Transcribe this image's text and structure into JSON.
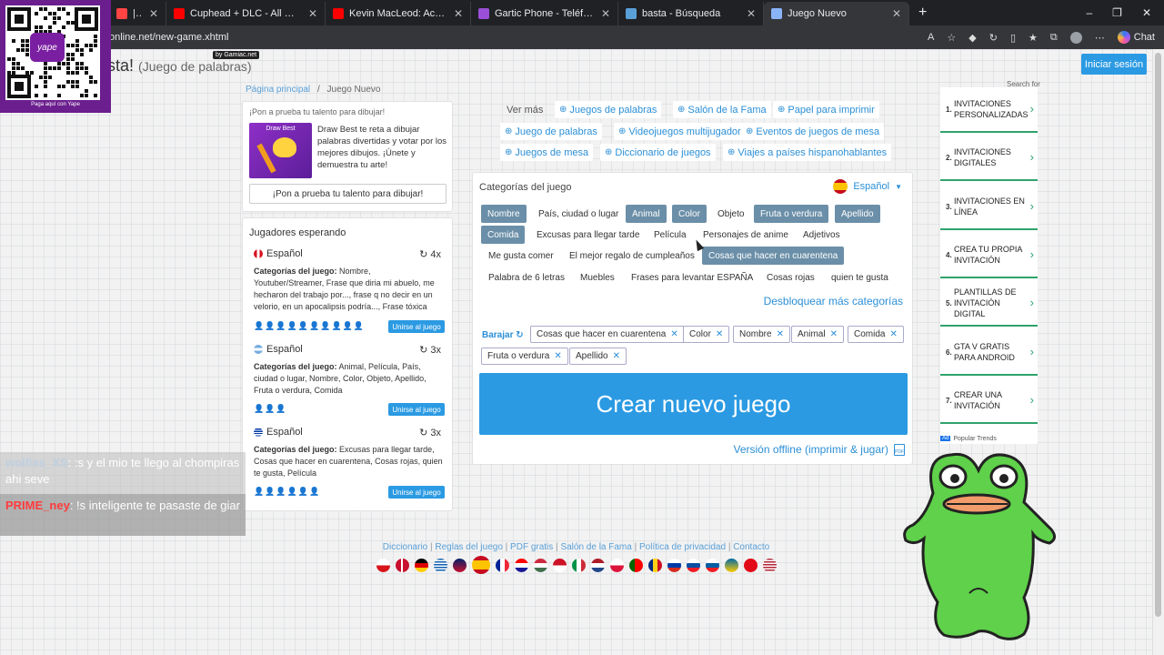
{
  "browser": {
    "tabs": [
      {
        "title": "|nl - Studiopo",
        "color": "#ff4444"
      },
      {
        "title": "Cuphead + DLC - All Bosses Sounc",
        "color": "#ff0000"
      },
      {
        "title": "Kevin MacLeod: Aces High bu",
        "color": "#ff0000"
      },
      {
        "title": "Gartic Phone - Teléfono Descomp",
        "color": "#9b4fd6"
      },
      {
        "title": "basta - Búsqueda",
        "color": "#5aa0d8"
      },
      {
        "title": "Juego Nuevo",
        "color": "#8ab4f8"
      }
    ],
    "url": "online.net/new-game.xhtml",
    "chat_label": "Chat"
  },
  "header": {
    "title": "sta!",
    "subtitle": "(Juego de palabras)",
    "badge": "by Gamiac.net",
    "login": "Iniciar sesión"
  },
  "breadcrumb": {
    "home": "Página principal",
    "sep": "/",
    "current": "Juego Nuevo"
  },
  "promo": {
    "title": "¡Pon a prueba tu talento para dibujar!",
    "image_caption": "Draw Best",
    "text": "Draw Best te reta a dibujar palabras divertidas y votar por los mejores dibujos. ¡Únete y demuestra tu arte!",
    "button": "¡Pon a prueba tu talento para dibujar!"
  },
  "players": {
    "title": "Jugadores esperando",
    "cats_label": "Categorías del juego:",
    "join_label": "Unirse al juego",
    "games": [
      {
        "lang": "Español",
        "flag": "peru",
        "count": "4x",
        "cats": "Nombre, Youtuber/Streamer, Frase que diria mi abuelo, me hecharon del trabajo por..., frase q no decir en un velorio, en un apocalipsis podría..., Frase tóxica",
        "people": "👤👤👤👤👤👤👤👤👤👤"
      },
      {
        "lang": "Español",
        "flag": "argentina",
        "count": "3x",
        "cats": "Animal, Película, País, ciudad o lugar, Nombre, Color, Objeto, Apellido, Fruta o verdura, Comida",
        "people": "👤👤👤"
      },
      {
        "lang": "Español",
        "flag": "uruguay",
        "count": "3x",
        "cats": "Excusas para llegar tarde, Cosas que hacer en cuarentena, Cosas rojas, quien te gusta, Película",
        "people": "👤👤👤👤👤👤"
      }
    ]
  },
  "toplinks": {
    "ver_mas": "Ver más",
    "links": [
      "Juegos de palabras",
      "Salón de la Fama",
      "Papel para imprimir",
      "Juego de palabras",
      "Videojuegos multijugador",
      "Eventos de juegos de mesa",
      "Juegos de mesa",
      "Diccionario de juegos",
      "Viajes a países hispanohablantes"
    ]
  },
  "game": {
    "title": "Categorías del juego",
    "language": "Español",
    "categories": [
      {
        "label": "Nombre",
        "selected": true
      },
      {
        "label": "País, ciudad o lugar",
        "selected": false
      },
      {
        "label": "Animal",
        "selected": true
      },
      {
        "label": "Color",
        "selected": true
      },
      {
        "label": "Objeto",
        "selected": false
      },
      {
        "label": "Fruta o verdura",
        "selected": true
      },
      {
        "label": "Apellido",
        "selected": true
      },
      {
        "label": "Comida",
        "selected": true
      },
      {
        "label": "Excusas para llegar tarde",
        "selected": false
      },
      {
        "label": "Película",
        "selected": false
      },
      {
        "label": "Personajes de anime",
        "selected": false
      },
      {
        "label": "Adjetivos",
        "selected": false
      },
      {
        "label": "Me gusta comer",
        "selected": false
      },
      {
        "label": "El mejor regalo de cumpleaños",
        "selected": false
      },
      {
        "label": "Cosas que hacer en cuarentena",
        "selected": true
      },
      {
        "label": "Palabra de 6 letras",
        "selected": false
      },
      {
        "label": "Muebles",
        "selected": false
      },
      {
        "label": "Frases para levantar ESPAÑA",
        "selected": false
      },
      {
        "label": "Cosas rojas",
        "selected": false
      },
      {
        "label": "quien te gusta",
        "selected": false
      }
    ],
    "unlock": "Desbloquear más categorías",
    "shuffle": "Barajar",
    "chosen": [
      "Cosas que hacer en cuarentena",
      "Color",
      "Nombre",
      "Animal",
      "Comida",
      "Fruta o verdura",
      "Apellido"
    ],
    "create": "Crear nuevo juego",
    "offline": "Versión offline (imprimir & jugar)"
  },
  "ads": {
    "label": "Search for",
    "items": [
      {
        "n": "1.",
        "text": "INVITACIONES PERSONALIZADAS"
      },
      {
        "n": "2.",
        "text": "INVITACIONES DIGITALES"
      },
      {
        "n": "3.",
        "text": "INVITACIONES EN LÍNEA"
      },
      {
        "n": "4.",
        "text": "CREA TU PROPIA INVITACIÓN"
      },
      {
        "n": "5.",
        "text": "PLANTILLAS DE INVITACIÓN DIGITAL"
      },
      {
        "n": "6.",
        "text": "GTA V GRATIS PARA ANDROID"
      },
      {
        "n": "7.",
        "text": "CREAR UNA INVITACIÓN"
      }
    ],
    "footer": "Popular Trends"
  },
  "footer": {
    "links": [
      "Diccionario",
      "Reglas del juego",
      "PDF gratis",
      "Salón de la Fama",
      "Política de privacidad",
      "Contacto"
    ]
  },
  "overlay": {
    "qr_caption": "Paga aquí con Yape",
    "qr_brand": "yape",
    "chat1_user": "wolfies_XS",
    "chat1_text": ": :s y el mio te llego al chompiras ahi seve",
    "chat2_user": "PRIME_ney",
    "chat2_text": ": !s inteligente te pasaste de giar"
  }
}
